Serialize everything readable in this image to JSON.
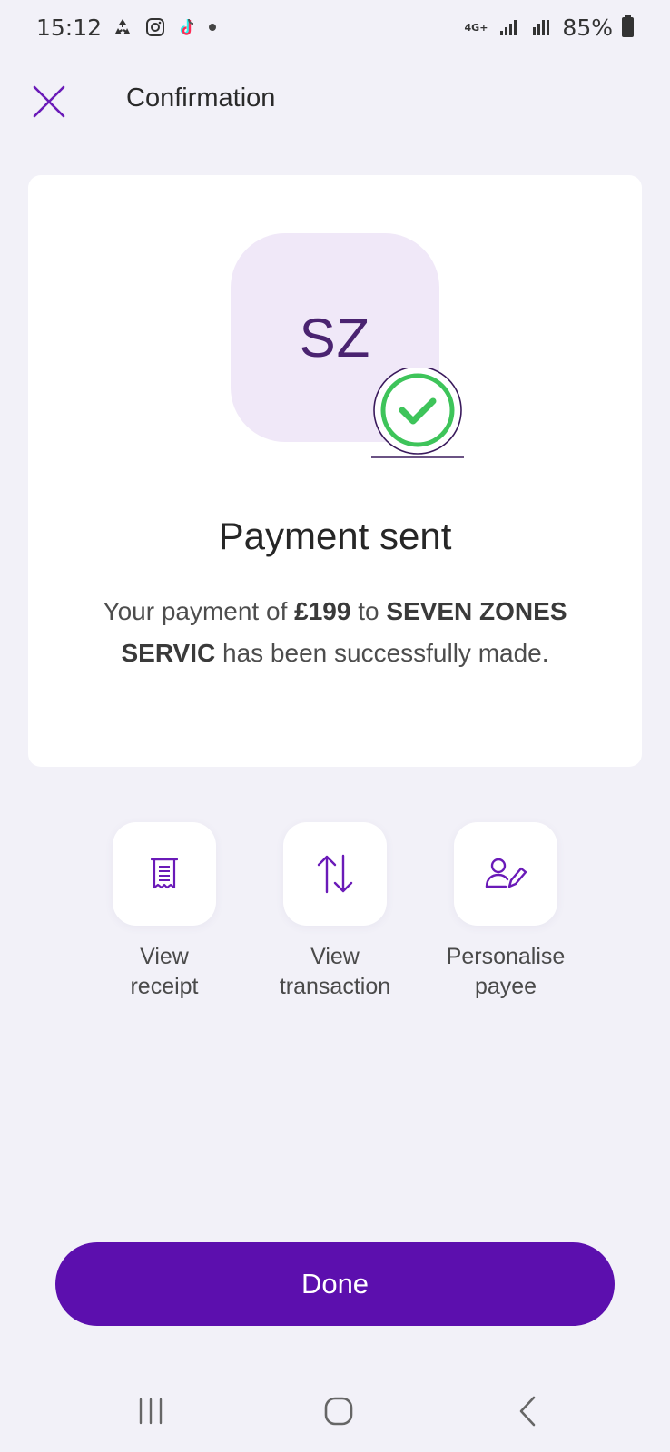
{
  "status_bar": {
    "time": "15:12",
    "network": "4G+",
    "battery": "85%",
    "icons": [
      "recycle-icon",
      "instagram-icon",
      "tiktok-icon",
      "dot-icon",
      "signal-icon",
      "signal-roaming-icon",
      "battery-icon"
    ]
  },
  "header": {
    "title": "Confirmation",
    "close_icon": "close-icon"
  },
  "card": {
    "initials": "SZ",
    "badge_icon": "check-circle-icon",
    "title": "Payment sent",
    "desc_prefix": "Your payment of ",
    "amount": "£199",
    "desc_middle": " to ",
    "payee": "SEVEN ZONES SERVIC",
    "desc_suffix": " has been successfully made."
  },
  "actions": [
    {
      "label_line1": "View",
      "label_line2": "receipt",
      "icon": "receipt-icon"
    },
    {
      "label_line1": "View",
      "label_line2": "transaction",
      "icon": "transfer-arrows-icon"
    },
    {
      "label_line1": "Personalise",
      "label_line2": "payee",
      "icon": "edit-person-icon"
    }
  ],
  "done_label": "Done",
  "nav": {
    "recents": "recents-icon",
    "home": "home-icon",
    "back": "back-icon"
  },
  "colors": {
    "accent": "#5c0fae",
    "avatar_bg": "#f0e8f8",
    "avatar_text": "#4a2370",
    "check_green": "#3ec45a",
    "background": "#f2f1f8"
  }
}
